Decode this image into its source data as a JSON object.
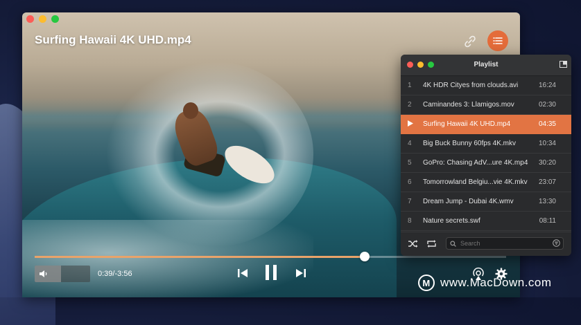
{
  "player": {
    "title": "Surfing Hawaii 4K UHD.mp4",
    "current_time": "0:39",
    "total_time": "-3:56",
    "time_separator": "/",
    "progress_fraction": 0.7,
    "volume_fraction": 0.48,
    "accent_color": "#e46c3a"
  },
  "playlist": {
    "title": "Playlist",
    "search_placeholder": "Search",
    "items": [
      {
        "index": "1",
        "name": "4K HDR Cityes from clouds.avi",
        "duration": "16:24",
        "active": false
      },
      {
        "index": "2",
        "name": "Caminandes 3: Llamigos.mov",
        "duration": "02:30",
        "active": false
      },
      {
        "index": "",
        "name": "Surfing Hawaii 4K UHD.mp4",
        "duration": "04:35",
        "active": true
      },
      {
        "index": "4",
        "name": "Big Buck Bunny 60fps 4K.mkv",
        "duration": "10:34",
        "active": false
      },
      {
        "index": "5",
        "name": "GoPro: Chasing AdV...ure 4K.mp4",
        "duration": "30:20",
        "active": false
      },
      {
        "index": "6",
        "name": "Tomorrowland Belgiu...vie 4K.mkv",
        "duration": "23:07",
        "active": false
      },
      {
        "index": "7",
        "name": "Dream Jump - Dubai 4K.wmv",
        "duration": "13:30",
        "active": false
      },
      {
        "index": "8",
        "name": "Nature secrets.swf",
        "duration": "08:11",
        "active": false
      }
    ]
  },
  "watermark": {
    "logo_letter": "M",
    "text": "www.MacDown.com"
  },
  "icons": [
    "link-icon",
    "list-icon",
    "volume-icon",
    "previous-icon",
    "pause-icon",
    "next-icon",
    "airplay-icon",
    "gear-icon",
    "shuffle-icon",
    "repeat-icon",
    "search-icon",
    "filter-icon",
    "expand-icon",
    "play-indicator-icon"
  ]
}
